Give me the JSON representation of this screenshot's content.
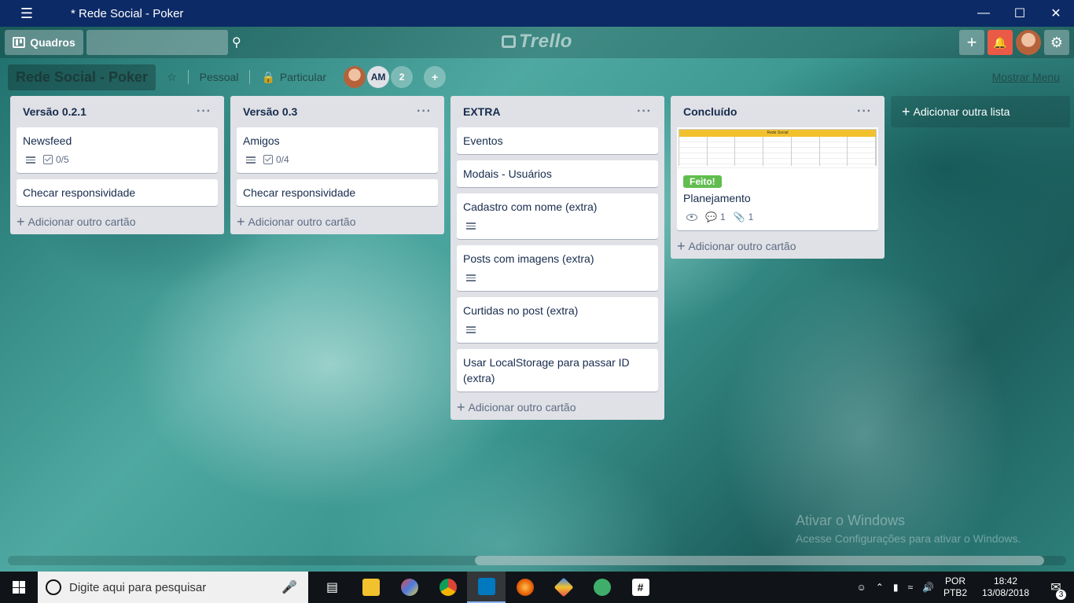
{
  "window": {
    "title": "* Rede Social - Poker",
    "menu_icon": "hamburger-icon",
    "minimize": "—",
    "maximize": "☐",
    "close": "✕"
  },
  "header": {
    "boards_label": "Quadros",
    "search_placeholder": "",
    "logo_text": "Trello",
    "add_icon": "+",
    "notification_icon": "bell-icon",
    "settings_icon": "gear-icon"
  },
  "board": {
    "name": "Rede Social - Poker",
    "team": "Pessoal",
    "visibility": "Particular",
    "members": [
      {
        "initials": "",
        "type": "photo"
      },
      {
        "initials": "AM",
        "type": "initials"
      },
      {
        "initials": "2",
        "type": "count"
      }
    ],
    "show_menu": "Mostrar Menu"
  },
  "lists": [
    {
      "title": "Versão 0.2.1",
      "cards": [
        {
          "title": "Newsfeed",
          "has_description": true,
          "checklist": "0/5"
        },
        {
          "title": "Checar responsividade"
        }
      ],
      "add_card": "Adicionar outro cartão"
    },
    {
      "title": "Versão 0.3",
      "cards": [
        {
          "title": "Amigos",
          "has_description": true,
          "checklist": "0/4"
        },
        {
          "title": "Checar responsividade"
        }
      ],
      "add_card": "Adicionar outro cartão"
    },
    {
      "title": "EXTRA",
      "cards": [
        {
          "title": "Eventos"
        },
        {
          "title": "Modais - Usuários"
        },
        {
          "title": "Cadastro com nome (extra)",
          "has_description": true
        },
        {
          "title": "Posts com imagens (extra)",
          "has_description": true
        },
        {
          "title": "Curtidas no post (extra)",
          "has_description": true
        },
        {
          "title": "Usar LocalStorage para passar ID (extra)"
        }
      ],
      "add_card": "Adicionar outro cartão"
    },
    {
      "title": "Concluído",
      "cards": [
        {
          "cover_title": "Rede Social",
          "label": "Feito!",
          "label_color": "#61bd4f",
          "title": "Planejamento",
          "comments": "1",
          "attachments": "1"
        }
      ],
      "add_card": "Adicionar outro cartão"
    }
  ],
  "add_list": "Adicionar outra lista",
  "watermark": {
    "line1": "Ativar o Windows",
    "line2": "Acesse Configurações para ativar o Windows."
  },
  "taskbar": {
    "search_placeholder": "Digite aqui para pesquisar",
    "apps": [
      "task-view-icon",
      "file-explorer-icon",
      "paint-icon",
      "chrome-icon",
      "trello-icon",
      "firefox-icon",
      "git-icon",
      "atom-icon",
      "slack-icon"
    ],
    "language": "POR",
    "keyboard": "PTB2",
    "time": "18:42",
    "date": "13/08/2018",
    "notifications_count": "3"
  },
  "colors": {
    "titlebar": "#0c2a66",
    "list_bg": "#dfe1e6",
    "notification": "#eb5a46",
    "label_green": "#61bd4f"
  }
}
